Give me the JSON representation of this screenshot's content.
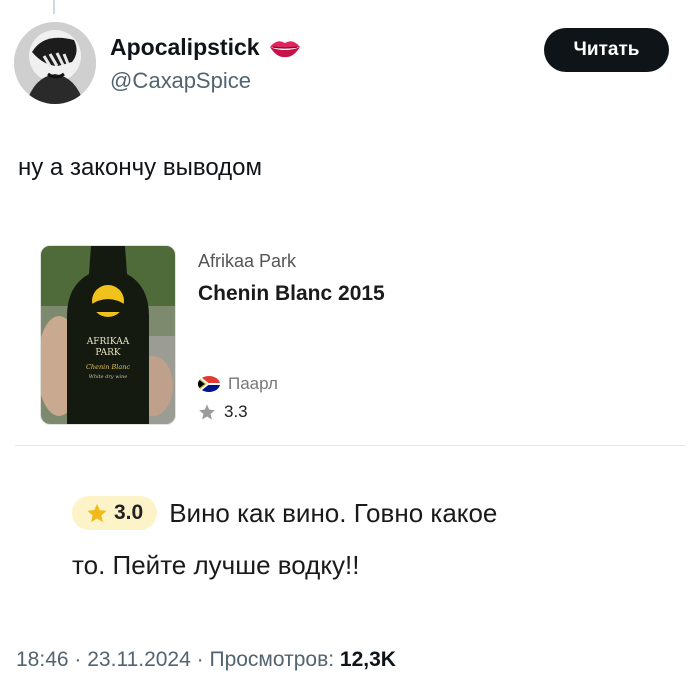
{
  "tweet": {
    "author_name": "Apocalipstick",
    "author_handle": "@СахарSpice",
    "follow_label": "Читать",
    "text": "ну а закончу выводом",
    "time": "18:46",
    "separator": "·",
    "date": "23.11.2024",
    "views_label": "Просмотров:",
    "views_count": "12,3K"
  },
  "wine_card": {
    "winery": "Afrikaa Park",
    "wine_name": "Chenin Blanc 2015",
    "region": "Паарл",
    "avg_rating": "3.3",
    "label_line1": "AFRIKAA",
    "label_line2": "PARK",
    "label_line3": "Chenin Blanc",
    "label_line4": "White dry wine"
  },
  "review": {
    "user_rating": "3.0",
    "text_line1": "Вино как вино. Говно какое",
    "text_line2": "то. Пейте лучше водку!!"
  },
  "colors": {
    "follow_button_bg": "#0f1419",
    "rating_pill_bg": "#fdf3c8",
    "star_gold": "#f2b91a",
    "handle_grey": "#536471"
  },
  "icons": [
    "lips-icon",
    "south-africa-flag-icon",
    "star-icon",
    "star-filled-icon"
  ]
}
